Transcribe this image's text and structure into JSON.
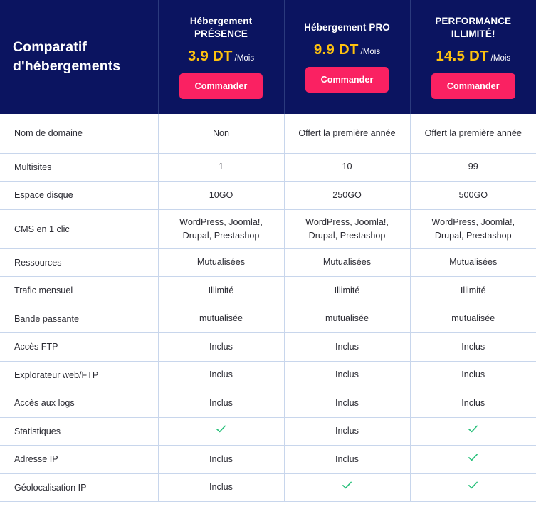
{
  "header": {
    "title_lines": [
      "Comparatif",
      "d'hébergements"
    ],
    "navy": "#0B1460",
    "accent_price": "#FFC20E",
    "accent_button": "#FA2162",
    "check_color": "#27C07A",
    "plans": [
      {
        "name_lines": [
          "Hébergement",
          "PRÉSENCE"
        ],
        "price": "3.9 DT",
        "period": "/Mois",
        "cta": "Commander"
      },
      {
        "name_lines": [
          "Hébergement PRO"
        ],
        "price": "9.9 DT",
        "period": "/Mois",
        "cta": "Commander"
      },
      {
        "name_lines": [
          "PERFORMANCE",
          "ILLIMITÉ!"
        ],
        "price": "14.5 DT",
        "period": "/Mois",
        "cta": "Commander"
      }
    ]
  },
  "rows": [
    {
      "feature": "Nom de domaine",
      "tall": true,
      "values": [
        "Non",
        "Offert la première année",
        "Offert la première année"
      ]
    },
    {
      "feature": "Multisites",
      "tall": false,
      "values": [
        "1",
        "10",
        "99"
      ]
    },
    {
      "feature": "Espace disque",
      "tall": false,
      "values": [
        "10GO",
        "250GO",
        "500GO"
      ]
    },
    {
      "feature": "CMS en 1 clic",
      "tall": true,
      "values": [
        "WordPress, Joomla!, Drupal, Prestashop",
        "WordPress, Joomla!, Drupal, Prestashop",
        "WordPress, Joomla!, Drupal, Prestashop"
      ]
    },
    {
      "feature": "Ressources",
      "tall": false,
      "values": [
        "Mutualisées",
        "Mutualisées",
        "Mutualisées"
      ]
    },
    {
      "feature": "Trafic mensuel",
      "tall": false,
      "values": [
        "Illimité",
        "Illimité",
        "Illimité"
      ]
    },
    {
      "feature": "Bande passante",
      "tall": false,
      "values": [
        "mutualisée",
        "mutualisée",
        "mutualisée"
      ]
    },
    {
      "feature": "Accès FTP",
      "tall": false,
      "values": [
        "Inclus",
        "Inclus",
        "Inclus"
      ]
    },
    {
      "feature": "Explorateur web/FTP",
      "tall": false,
      "values": [
        "Inclus",
        "Inclus",
        "Inclus"
      ]
    },
    {
      "feature": "Accès aux logs",
      "tall": false,
      "values": [
        "Inclus",
        "Inclus",
        "Inclus"
      ]
    },
    {
      "feature": "Statistiques",
      "tall": false,
      "values": [
        "check",
        "Inclus",
        "check"
      ]
    },
    {
      "feature": "Adresse IP",
      "tall": false,
      "values": [
        "Inclus",
        "Inclus",
        "check"
      ]
    },
    {
      "feature": "Géolocalisation IP",
      "tall": false,
      "values": [
        "Inclus",
        "check",
        "check"
      ]
    }
  ]
}
